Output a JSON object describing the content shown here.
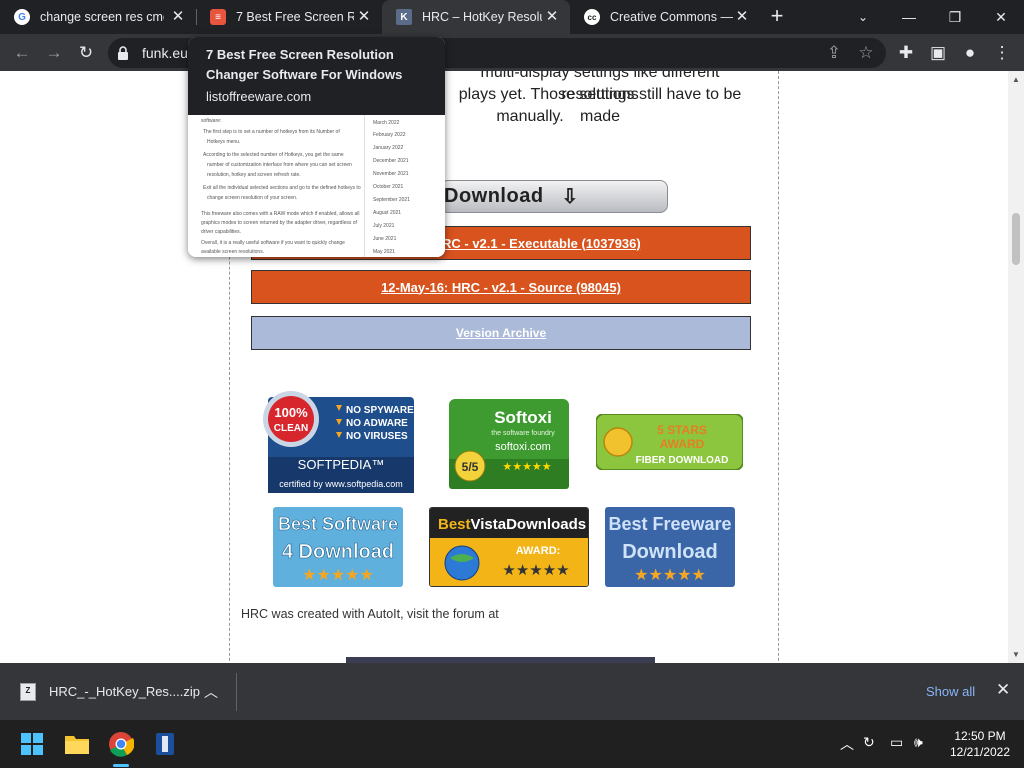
{
  "tabs": [
    {
      "title": "change screen res cmd",
      "icon": "google-icon",
      "active": false
    },
    {
      "title": "7 Best Free Screen Resolution Changer Software For Windows",
      "icon": "listoffreeware-icon",
      "active": false
    },
    {
      "title": "HRC – HotKey Resolution Changer",
      "icon": "funk-icon",
      "active": true
    },
    {
      "title": "Creative Commons — Attribution",
      "icon": "cc-icon",
      "active": false
    }
  ],
  "toolbar": {
    "url": "funk.eu"
  },
  "hovercard": {
    "title": "7 Best Free Screen Resolution Changer Software For Windows",
    "domain": "listoffreeware.com",
    "preview_lines": [
      "software:",
      "The first step is to set a number of hotkeys from its Number of",
      "Hotkeys menu.",
      "According to the selected number of Hotkeys, you get the same",
      "number of customization interface from where you can set screen",
      "resolution, hotkey and screen refresh rate.",
      "Exit all the individual selected sections and go to the defined hotkeys to",
      "change screen resolution of your screen.",
      "This freeware also comes with a RAW mode which if enabled, allows all",
      "graphics modes to screen returned by the adapter driver, regardless of",
      "driver capabilities.",
      "Overall, it is a really useful software if you want to quickly change",
      "available screen resolutions."
    ],
    "preview_months": [
      "March 2022",
      "February 2022",
      "January 2022",
      "December 2021",
      "November 2021",
      "October 2021",
      "September 2021",
      "August 2021",
      "July 2021",
      "June 2021",
      "May 2021"
    ]
  },
  "page": {
    "text_line1": "multi-display settings like different resolutions",
    "text_line2": "plays yet. Those settings still have to be made",
    "text_line3": "manually.",
    "download_graphic": "Download",
    "link_executable": "12-May-16: HRC - v2.1 - Executable (1037936)",
    "link_executable_visible": "RC - v2.1 - Executable (1037936)",
    "link_source": "12-May-16: HRC - v2.1 - Source (98045)",
    "link_archive": "Version Archive",
    "footer_text": "HRC was created with AutoIt, visit the forum at"
  },
  "badges": {
    "softpedia": {
      "label_clean": "100% CLEAN",
      "items": [
        "NO SPYWARE",
        "NO ADWARE",
        "NO VIRUSES"
      ],
      "brand": "SOFTPEDIA™",
      "footer": "certified by www.softpedia.com"
    },
    "softoxi": {
      "brand": "Softoxi",
      "tagline": "the software foundry",
      "site": "softoxi.com",
      "score": "5/5"
    },
    "fiber": {
      "line1": "5 STARS",
      "line2": "AWARD",
      "line3": "FIBER DOWNLOAD"
    },
    "bs4d": {
      "line1": "Best Software",
      "line2": "4 Download"
    },
    "bvd": {
      "brand1": "Best",
      "brand2": "VistaDownloads",
      "award": "AWARD:"
    },
    "bfd": {
      "line1": "Best Freeware",
      "line2": "Download"
    }
  },
  "downloads": {
    "file_name": "HRC_-_HotKey_Res....zip",
    "show_all": "Show all"
  },
  "taskbar": {
    "time": "12:50 PM",
    "date": "12/21/2022"
  },
  "colors": {
    "accent_orange": "#d9531e",
    "archive_blue": "#aabad8",
    "chrome_dark": "#202124",
    "link_blue": "#8ab4f8"
  }
}
